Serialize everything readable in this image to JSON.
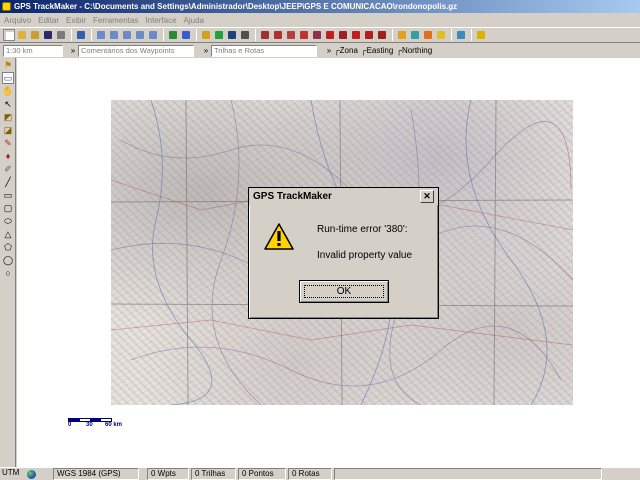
{
  "window": {
    "title": "GPS TrackMaker - C:\\Documents and Settings\\Administrador\\Desktop\\JEEP\\GPS E COMUNICACAO\\rondonopolis.gz"
  },
  "menu": [
    "Arquivo",
    "Editar",
    "Exibir",
    "Ferramentas",
    "Interface",
    "Ajuda"
  ],
  "toolbar2": {
    "scale_value": "1:30 km",
    "waypoint_comments_placeholder": "Comentários dos Waypoints",
    "tracks_routes_placeholder": "Trilhas e Rotas",
    "zona_label": "Zona",
    "easting_label": "Easting",
    "northing_label": "Northing"
  },
  "scalebar": {
    "labels": [
      "0",
      "30",
      "60 km"
    ]
  },
  "dialog": {
    "title": "GPS TrackMaker",
    "close_glyph": "✕",
    "message_line1": "Run-time error '380':",
    "message_line2": "Invalid property value",
    "ok_label": "OK",
    "icon": "warning-icon"
  },
  "statusbar": {
    "projection": "UTM",
    "datum": "WGS 1984 (GPS)",
    "waypoints": "0 Wpts",
    "tracks": "0 Trilhas",
    "points": "0 Pontos",
    "routes": "0 Rotas"
  },
  "colors": {
    "titlebar_start": "#0a246a",
    "titlebar_end": "#a6caf0",
    "scalebar": "#00007f"
  }
}
